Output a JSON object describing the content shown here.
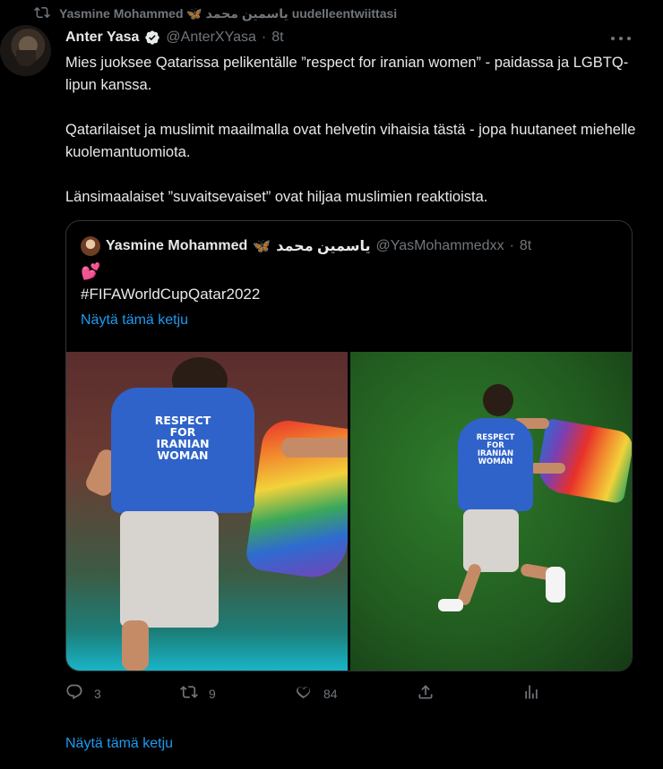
{
  "retweet": {
    "label": "Yasmine Mohammed 🦋 ياسمين محمد uudelleentwiittasi"
  },
  "tweet": {
    "author_name": "Anter Yasa",
    "handle": "@AnterXYasa",
    "separator": "·",
    "time": "8t",
    "paragraphs": [
      "Mies juoksee Qatarissa pelikentälle ”respect for iranian women” - paidassa ja LGBTQ-lipun kanssa.",
      "Qatarilaiset ja muslimit maailmalla ovat helvetin vihaisia tästä - jopa huutaneet miehelle kuolemantuomiota.",
      "Länsimaalaiset ”suvaitsevaiset” ovat hiljaa muslimien reaktioista."
    ]
  },
  "quote": {
    "author_name": "Yasmine Mohammed",
    "butterfly": "🦋",
    "arabic_name": "ياسمين محمد",
    "handle": "@YasMohammedxx",
    "separator": "·",
    "time": "8t",
    "emoji": "💕",
    "hashtag": "#FIFAWorldCupQatar2022",
    "show_thread": "Näytä tämä ketju",
    "photo_left": {
      "shirt_text": "RESPECT\nFOR\nIRANIAN\nWOMAN"
    },
    "photo_right": {
      "shirt_text": "RESPECT\nFOR\nIRANIAN\nWOMAN"
    }
  },
  "actions": {
    "replies": "3",
    "retweets": "9",
    "likes": "84"
  },
  "footer": {
    "show_thread": "Näytä tämä ketju"
  },
  "icons": {
    "retweet_header": "retweet-icon",
    "verified": "verified-badge-icon",
    "more": "more-icon",
    "reply": "reply-icon",
    "retweet": "retweet-icon",
    "like": "heart-icon",
    "share": "share-icon",
    "analytics": "analytics-icon"
  },
  "colors": {
    "background": "#000000",
    "text": "#e7e9ea",
    "muted": "#71767b",
    "link": "#1d9bf0",
    "border": "#2f3336"
  }
}
